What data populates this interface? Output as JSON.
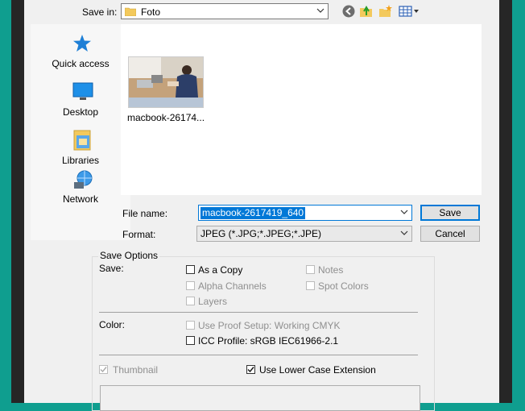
{
  "save_in": {
    "label": "Save in:",
    "value": "Foto"
  },
  "toolbar": {
    "back_icon": "back-arrow-icon",
    "up_icon": "up-folder-icon",
    "new_folder_icon": "new-folder-icon",
    "view_icon": "view-menu-icon"
  },
  "places": [
    {
      "label": "Quick access",
      "icon": "star-icon"
    },
    {
      "label": "Desktop",
      "icon": "desktop-icon"
    },
    {
      "label": "Libraries",
      "icon": "libraries-icon"
    },
    {
      "label": "Network",
      "icon": "network-icon"
    }
  ],
  "files": [
    {
      "caption": "macbook-26174..."
    }
  ],
  "file_name": {
    "label": "File name:",
    "value": "macbook-2617419_640"
  },
  "format": {
    "label": "Format:",
    "value": "JPEG (*.JPG;*.JPEG;*.JPE)"
  },
  "buttons": {
    "save": "Save",
    "cancel": "Cancel"
  },
  "save_options": {
    "title": "Save Options",
    "save_label": "Save:",
    "as_a_copy": "As a Copy",
    "notes": "Notes",
    "alpha_channels": "Alpha Channels",
    "spot_colors": "Spot Colors",
    "layers": "Layers",
    "color_label": "Color:",
    "use_proof_setup": "Use Proof Setup:  Working CMYK",
    "icc_profile": "ICC Profile:  sRGB IEC61966-2.1",
    "thumbnail": "Thumbnail",
    "lower_case_ext": "Use Lower Case Extension"
  },
  "colors": {
    "accent": "#0078d7",
    "background": "#f0f0f0",
    "frame": "#0f9e8f"
  }
}
